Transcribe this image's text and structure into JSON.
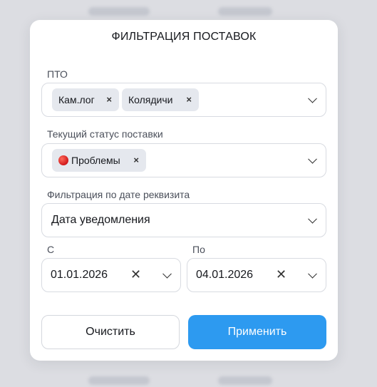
{
  "modal": {
    "title": "ФИЛЬТРАЦИЯ ПОСТАВОК",
    "pto": {
      "label": "ПТО",
      "chips": [
        "Кам.лог",
        "Колядичи"
      ],
      "remove_glyph": "×"
    },
    "status": {
      "label": "Текущий статус поставки",
      "chips": [
        "Проблемы"
      ],
      "chip_indicator_color": "#d0181b",
      "remove_glyph": "×"
    },
    "date_filter": {
      "label": "Фильтрация по дате реквизита",
      "selected": "Дата уведомления"
    },
    "range": {
      "from_label": "С",
      "from_value": "01.01.2026",
      "to_label": "По",
      "to_value": "04.01.2026",
      "clear_glyph": "✕"
    },
    "buttons": {
      "clear": "Очистить",
      "apply": "Применить",
      "apply_color": "#2d9af0"
    },
    "icons": [
      "close-icon",
      "chevron-down-icon",
      "status-dot-icon"
    ]
  }
}
